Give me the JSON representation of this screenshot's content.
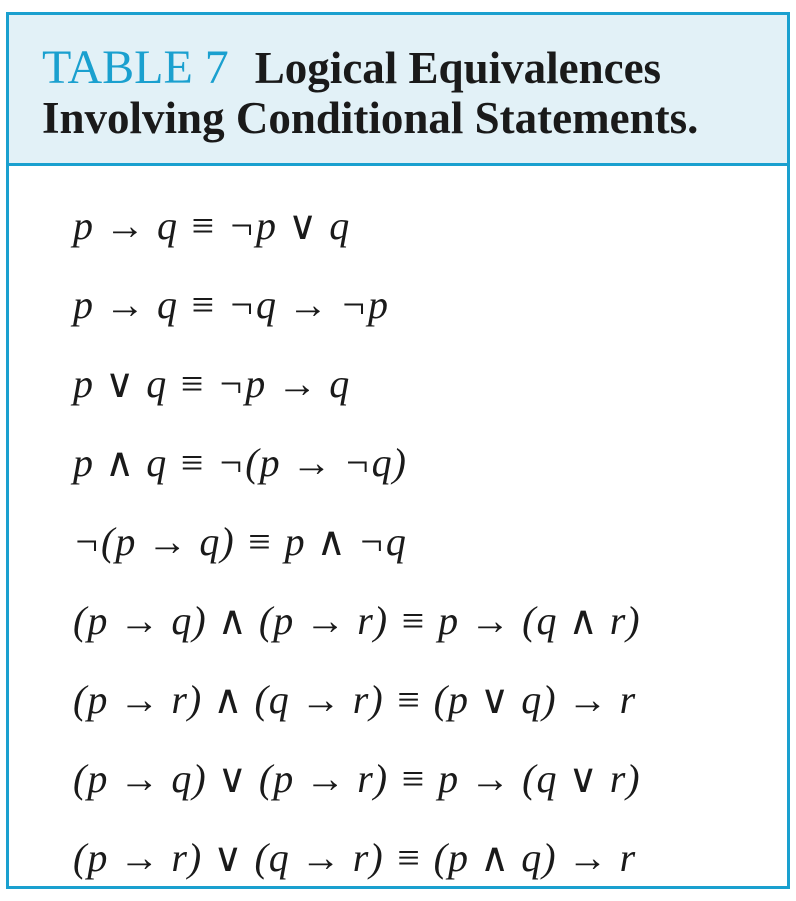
{
  "table": {
    "label": "TABLE 7",
    "title_line1": "Logical Equivalences",
    "title_line2": "Involving Conditional Statements."
  },
  "formulas": [
    "p → q ≡ ¬p ∨ q",
    "p → q ≡ ¬q → ¬p",
    "p ∨ q ≡ ¬p → q",
    "p ∧ q ≡ ¬(p → ¬q)",
    "¬(p → q) ≡ p ∧ ¬q",
    "(p → q) ∧ (p → r) ≡ p → (q ∧ r)",
    "(p → r) ∧ (q → r) ≡ (p ∨ q) → r",
    "(p → q) ∨ (p → r) ≡ p → (q ∨ r)",
    "(p → r) ∨ (q → r) ≡ (p ∧ q) → r"
  ],
  "colors": {
    "accent": "#1aa0cf",
    "header_bg": "#e2f1f7",
    "text": "#1a1a1a"
  }
}
